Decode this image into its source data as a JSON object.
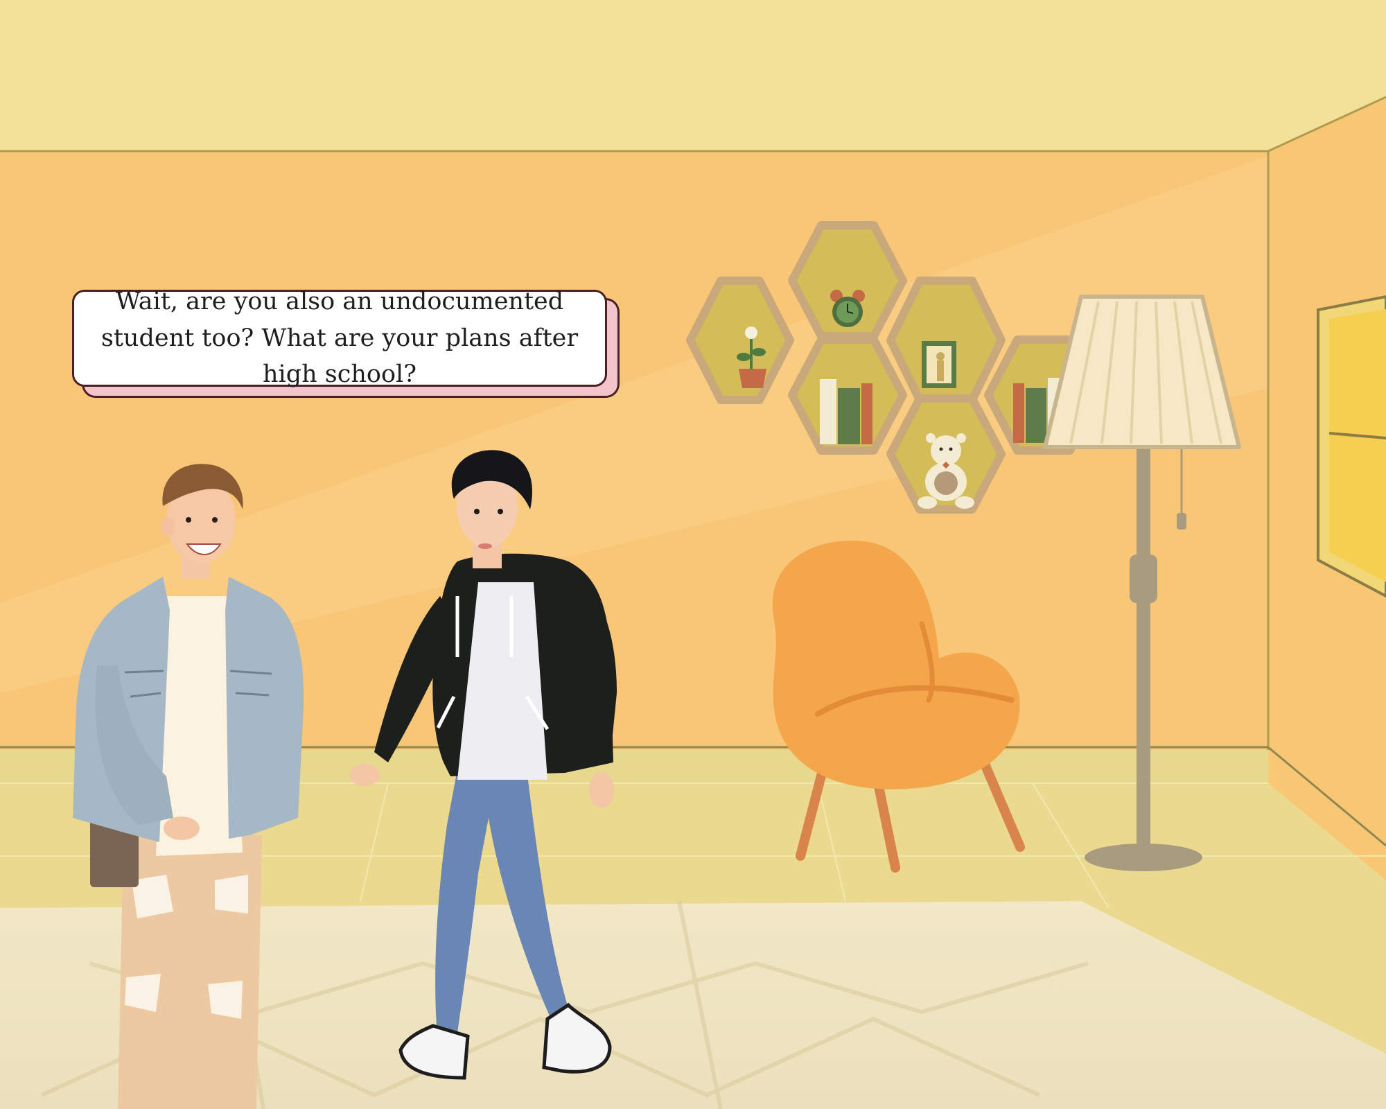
{
  "scene": {
    "dialogue": {
      "text": "Wait, are you also an undocumented student too? What are your plans after high school?"
    },
    "characters": [
      {
        "id": "character-smiling-denim-jacket"
      },
      {
        "id": "character-walking-black-hoodie"
      }
    ],
    "props": {
      "hex_shelf": [
        "clock",
        "potted-flower",
        "photo-frame",
        "books",
        "books",
        "teddy-bear"
      ],
      "clock_time": "11:55"
    }
  }
}
